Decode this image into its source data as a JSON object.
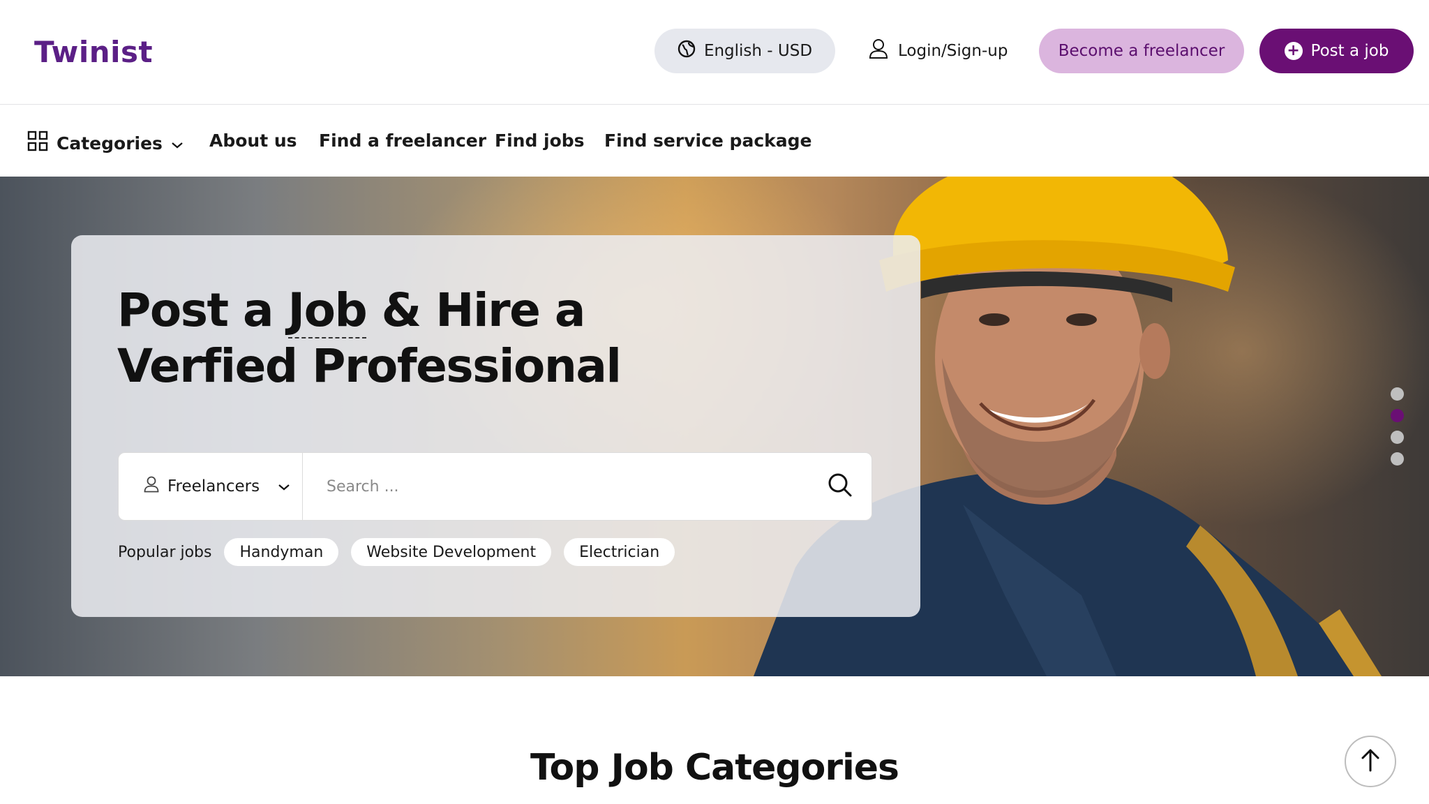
{
  "brand": {
    "logo_text": "Twinist",
    "primary_color": "#6a0f74",
    "accent_light": "#dbb5de"
  },
  "header": {
    "language": {
      "label": "English - USD",
      "icon": "globe-icon"
    },
    "login": {
      "label": "Login/Sign-up",
      "icon": "user-icon"
    },
    "become_freelancer": {
      "label": "Become a freelancer"
    },
    "post_job": {
      "label": "Post a job",
      "icon": "plus-circle-icon"
    }
  },
  "nav": {
    "categories": {
      "label": "Categories",
      "icon": "grid-icon"
    },
    "items": [
      {
        "label": "About us"
      },
      {
        "label": "Find a freelancer"
      },
      {
        "label": "Find jobs"
      },
      {
        "label": "Find service package"
      }
    ]
  },
  "hero": {
    "title_part1": "Post a ",
    "title_highlight": "Job",
    "title_part2": " & Hire a Verfied Professional",
    "search": {
      "type_selected": "Freelancers",
      "placeholder": "Search ..."
    },
    "popular": {
      "label": "Popular jobs",
      "tags": [
        "Handyman",
        "Website Development",
        "Electrician"
      ]
    },
    "slider": {
      "count": 4,
      "active_index": 1
    }
  },
  "section": {
    "title": "Top Job Categories"
  }
}
